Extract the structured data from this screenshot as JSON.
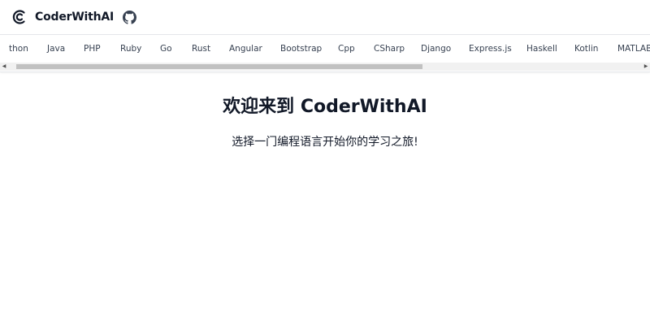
{
  "header": {
    "brand_name": "CoderWithAI",
    "logo_icon": "c-logo-icon",
    "github_icon": "github-icon"
  },
  "nav": {
    "items": [
      {
        "label": "thon"
      },
      {
        "label": "Java"
      },
      {
        "label": "PHP"
      },
      {
        "label": "Ruby"
      },
      {
        "label": "Go"
      },
      {
        "label": "Rust"
      },
      {
        "label": "Angular"
      },
      {
        "label": "Bootstrap"
      },
      {
        "label": "Cpp"
      },
      {
        "label": "CSharp"
      },
      {
        "label": "Django"
      },
      {
        "label": "Express.js"
      },
      {
        "label": "Haskell"
      },
      {
        "label": "Kotlin"
      },
      {
        "label": "MATLAB"
      }
    ]
  },
  "main": {
    "title": "欢迎来到 CoderWithAI",
    "subtitle": "选择一门编程语言开始你的学习之旅!"
  },
  "colors": {
    "text": "#111827",
    "nav_text": "#374151",
    "border": "#e5e7eb",
    "scroll_thumb": "#c1c1c1"
  }
}
